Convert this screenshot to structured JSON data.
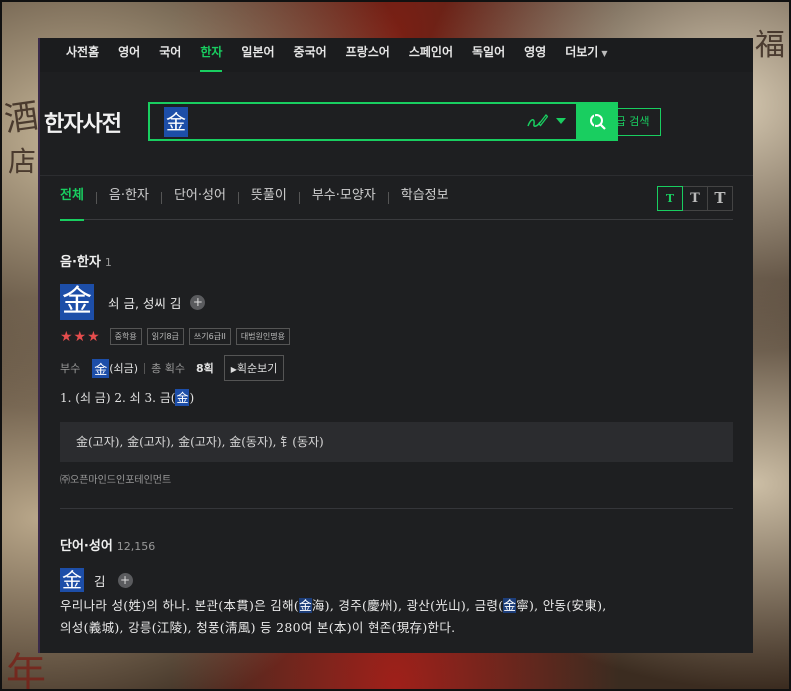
{
  "background": {
    "chars": [
      "酒",
      "店",
      "年",
      "福"
    ]
  },
  "topnav": {
    "items": [
      {
        "label": "사전홈",
        "active": false
      },
      {
        "label": "영어",
        "active": false
      },
      {
        "label": "국어",
        "active": false
      },
      {
        "label": "한자",
        "active": true
      },
      {
        "label": "일본어",
        "active": false
      },
      {
        "label": "중국어",
        "active": false
      },
      {
        "label": "프랑스어",
        "active": false
      },
      {
        "label": "스페인어",
        "active": false
      },
      {
        "label": "독일어",
        "active": false
      },
      {
        "label": "영영",
        "active": false
      },
      {
        "label": "더보기",
        "active": false,
        "dropdown": true
      }
    ]
  },
  "header": {
    "logo": "한자사전",
    "search": {
      "value": "金",
      "handwrite_icon": "handwriting-pen-icon",
      "search_icon": "magnifier-icon"
    },
    "advanced_label": "고급 검색"
  },
  "tabs": {
    "items": [
      {
        "label": "전체",
        "active": true
      },
      {
        "label": "음·한자",
        "active": false
      },
      {
        "label": "단어·성어",
        "active": false
      },
      {
        "label": "뜻풀이",
        "active": false
      },
      {
        "label": "부수·모양자",
        "active": false
      },
      {
        "label": "학습정보",
        "active": false
      }
    ],
    "font_sizes": [
      "T",
      "T",
      "T"
    ]
  },
  "hanja_section": {
    "title": "음·한자",
    "count": "1",
    "entry": {
      "char": "金",
      "reading": "쇠 금, 성씨 김",
      "stars": "★★★",
      "badges": [
        "중학용",
        "읽기8급",
        "쓰기6급II",
        "대법원인명용"
      ],
      "radical_label": "부수",
      "radical_char": "金",
      "radical_name": "(쇠금)",
      "strokes_label": "총 획수",
      "strokes_value": "8획",
      "stroke_button": "획순보기",
      "meanings_prefix": "1. (쇠 금)  2. 쇠  3. 금(",
      "meanings_char": "金",
      "meanings_suffix": ")"
    },
    "variants": "金(고자), 金(고자), 金(고자), 金(동자), 钅(동자)",
    "copyright": "㈜오픈마인드인포테인먼트"
  },
  "words_section": {
    "title": "단어·성어",
    "count": "12,156",
    "entry": {
      "char": "金",
      "reading": "김",
      "desc_parts": [
        "우리나라 성(姓)의 하나. 본관(本貫)은 김해(",
        "金",
        "海), 경주(慶州), 광산(光山), 금령(",
        "金",
        "寧), 안동(安東),",
        "의성(義城), 강릉(江陵), 청풍(淸風) 등 280여 본(本)이 현존(現存)한다."
      ]
    }
  }
}
